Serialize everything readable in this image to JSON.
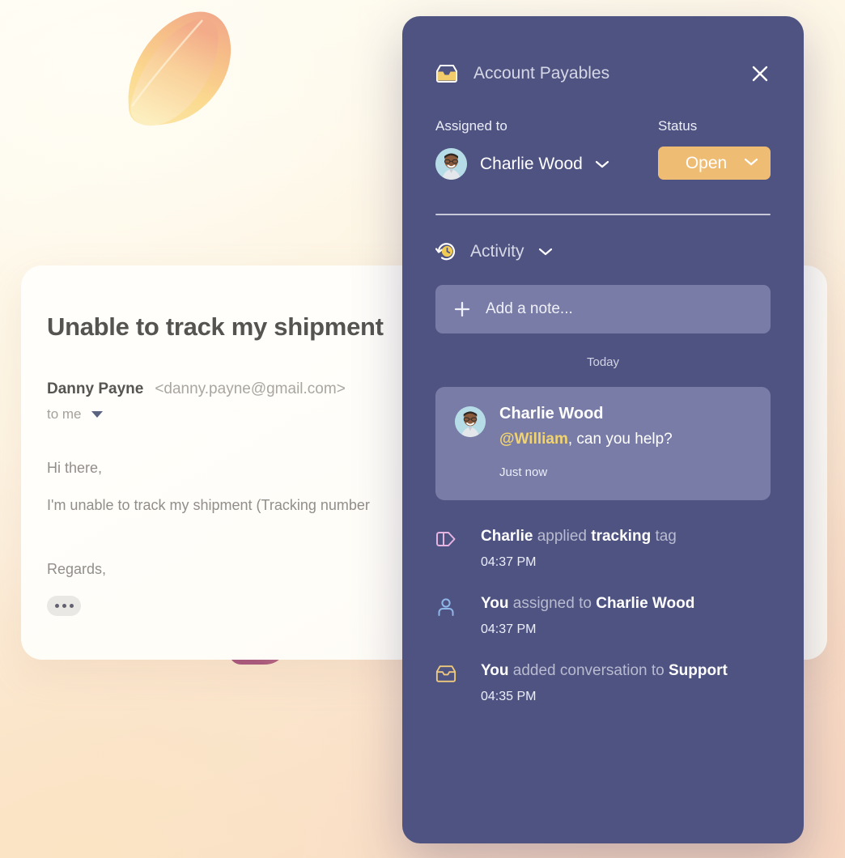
{
  "email": {
    "subject": "Unable to track my shipment",
    "sender_name": "Danny Payne",
    "sender_address": "<danny.payne@gmail.com>",
    "recipient": "to me",
    "body_lines": [
      "Hi there,",
      "I'm unable to track my shipment (Tracking number"
    ],
    "signoff": "Regards,",
    "more_button_label": "more-options"
  },
  "panel": {
    "title": "Account Payables",
    "close_label": "Close",
    "assigned": {
      "label": "Assigned to",
      "assignee": "Charlie Wood"
    },
    "status": {
      "label": "Status",
      "value": "Open"
    },
    "activity": {
      "title": "Activity",
      "add_note_placeholder": "Add a note...",
      "day_label": "Today",
      "note": {
        "author": "Charlie Wood",
        "mention": "@William",
        "text_rest": ", can you help?",
        "time": "Just now"
      },
      "entries": [
        {
          "icon": "tag-icon",
          "icon_color": "#e6b4e0",
          "parts": [
            {
              "text": "Charlie",
              "style": "strong"
            },
            {
              "text": "applied",
              "style": "muted"
            },
            {
              "text": "tracking",
              "style": "strong"
            },
            {
              "text": "tag",
              "style": "muted"
            }
          ],
          "time": "04:37 PM"
        },
        {
          "icon": "person-icon",
          "icon_color": "#8fb6e8",
          "parts": [
            {
              "text": "You",
              "style": "strong"
            },
            {
              "text": "assigned to",
              "style": "muted"
            },
            {
              "text": "Charlie Wood",
              "style": "strong"
            }
          ],
          "time": "04:37 PM"
        },
        {
          "icon": "inbox-icon",
          "icon_color": "#efc97e",
          "parts": [
            {
              "text": "You",
              "style": "strong"
            },
            {
              "text": "added conversation to",
              "style": "muted"
            },
            {
              "text": "Support",
              "style": "strong"
            }
          ],
          "time": "04:35 PM"
        }
      ]
    }
  },
  "colors": {
    "panel_bg": "#4f5381",
    "panel_surface": "#787ca6",
    "accent_orange": "#efbc73",
    "accent_yellow": "#f2d46f",
    "card_bg": "#fffefb"
  }
}
